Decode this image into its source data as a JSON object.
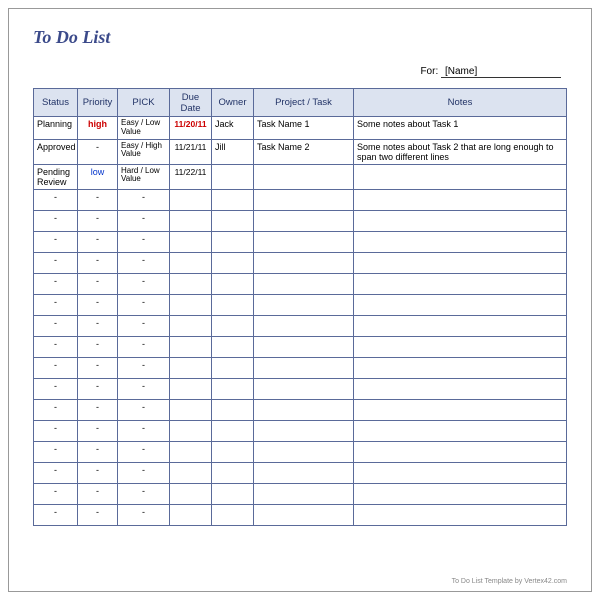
{
  "title": "To Do List",
  "for_label": "For:",
  "for_name": "[Name]",
  "columns": [
    "Status",
    "Priority",
    "PICK",
    "Due Date",
    "Owner",
    "Project / Task",
    "Notes"
  ],
  "rows": [
    {
      "status": "Planning",
      "priority": "high",
      "priority_class": "priority-high",
      "pick": "Easy / Low Value",
      "due": "11/20/11",
      "due_class": "due-red",
      "owner": "Jack",
      "task": "Task Name 1",
      "notes": "Some notes about Task 1"
    },
    {
      "status": "Approved",
      "priority": "-",
      "priority_class": "center",
      "pick": "Easy / High Value",
      "due": "11/21/11",
      "due_class": "due-norm",
      "owner": "Jill",
      "task": "Task Name 2",
      "notes": "Some notes about Task 2 that are long enough to span two different lines"
    },
    {
      "status": "Pending Review",
      "priority": "low",
      "priority_class": "priority-low",
      "pick": "Hard / Low Value",
      "due": "11/22/11",
      "due_class": "due-norm",
      "owner": "",
      "task": "",
      "notes": ""
    },
    {
      "status": "-",
      "priority": "-",
      "priority_class": "center",
      "pick": "-",
      "due": "",
      "due_class": "",
      "owner": "",
      "task": "",
      "notes": ""
    },
    {
      "status": "-",
      "priority": "-",
      "priority_class": "center",
      "pick": "-",
      "due": "",
      "due_class": "",
      "owner": "",
      "task": "",
      "notes": ""
    },
    {
      "status": "-",
      "priority": "-",
      "priority_class": "center",
      "pick": "-",
      "due": "",
      "due_class": "",
      "owner": "",
      "task": "",
      "notes": ""
    },
    {
      "status": "-",
      "priority": "-",
      "priority_class": "center",
      "pick": "-",
      "due": "",
      "due_class": "",
      "owner": "",
      "task": "",
      "notes": ""
    },
    {
      "status": "-",
      "priority": "-",
      "priority_class": "center",
      "pick": "-",
      "due": "",
      "due_class": "",
      "owner": "",
      "task": "",
      "notes": ""
    },
    {
      "status": "-",
      "priority": "-",
      "priority_class": "center",
      "pick": "-",
      "due": "",
      "due_class": "",
      "owner": "",
      "task": "",
      "notes": ""
    },
    {
      "status": "-",
      "priority": "-",
      "priority_class": "center",
      "pick": "-",
      "due": "",
      "due_class": "",
      "owner": "",
      "task": "",
      "notes": ""
    },
    {
      "status": "-",
      "priority": "-",
      "priority_class": "center",
      "pick": "-",
      "due": "",
      "due_class": "",
      "owner": "",
      "task": "",
      "notes": ""
    },
    {
      "status": "-",
      "priority": "-",
      "priority_class": "center",
      "pick": "-",
      "due": "",
      "due_class": "",
      "owner": "",
      "task": "",
      "notes": ""
    },
    {
      "status": "-",
      "priority": "-",
      "priority_class": "center",
      "pick": "-",
      "due": "",
      "due_class": "",
      "owner": "",
      "task": "",
      "notes": ""
    },
    {
      "status": "-",
      "priority": "-",
      "priority_class": "center",
      "pick": "-",
      "due": "",
      "due_class": "",
      "owner": "",
      "task": "",
      "notes": ""
    },
    {
      "status": "-",
      "priority": "-",
      "priority_class": "center",
      "pick": "-",
      "due": "",
      "due_class": "",
      "owner": "",
      "task": "",
      "notes": ""
    },
    {
      "status": "-",
      "priority": "-",
      "priority_class": "center",
      "pick": "-",
      "due": "",
      "due_class": "",
      "owner": "",
      "task": "",
      "notes": ""
    },
    {
      "status": "-",
      "priority": "-",
      "priority_class": "center",
      "pick": "-",
      "due": "",
      "due_class": "",
      "owner": "",
      "task": "",
      "notes": ""
    },
    {
      "status": "-",
      "priority": "-",
      "priority_class": "center",
      "pick": "-",
      "due": "",
      "due_class": "",
      "owner": "",
      "task": "",
      "notes": ""
    },
    {
      "status": "-",
      "priority": "-",
      "priority_class": "center",
      "pick": "-",
      "due": "",
      "due_class": "",
      "owner": "",
      "task": "",
      "notes": ""
    }
  ],
  "footer": "To Do List Template by Vertex42.com"
}
